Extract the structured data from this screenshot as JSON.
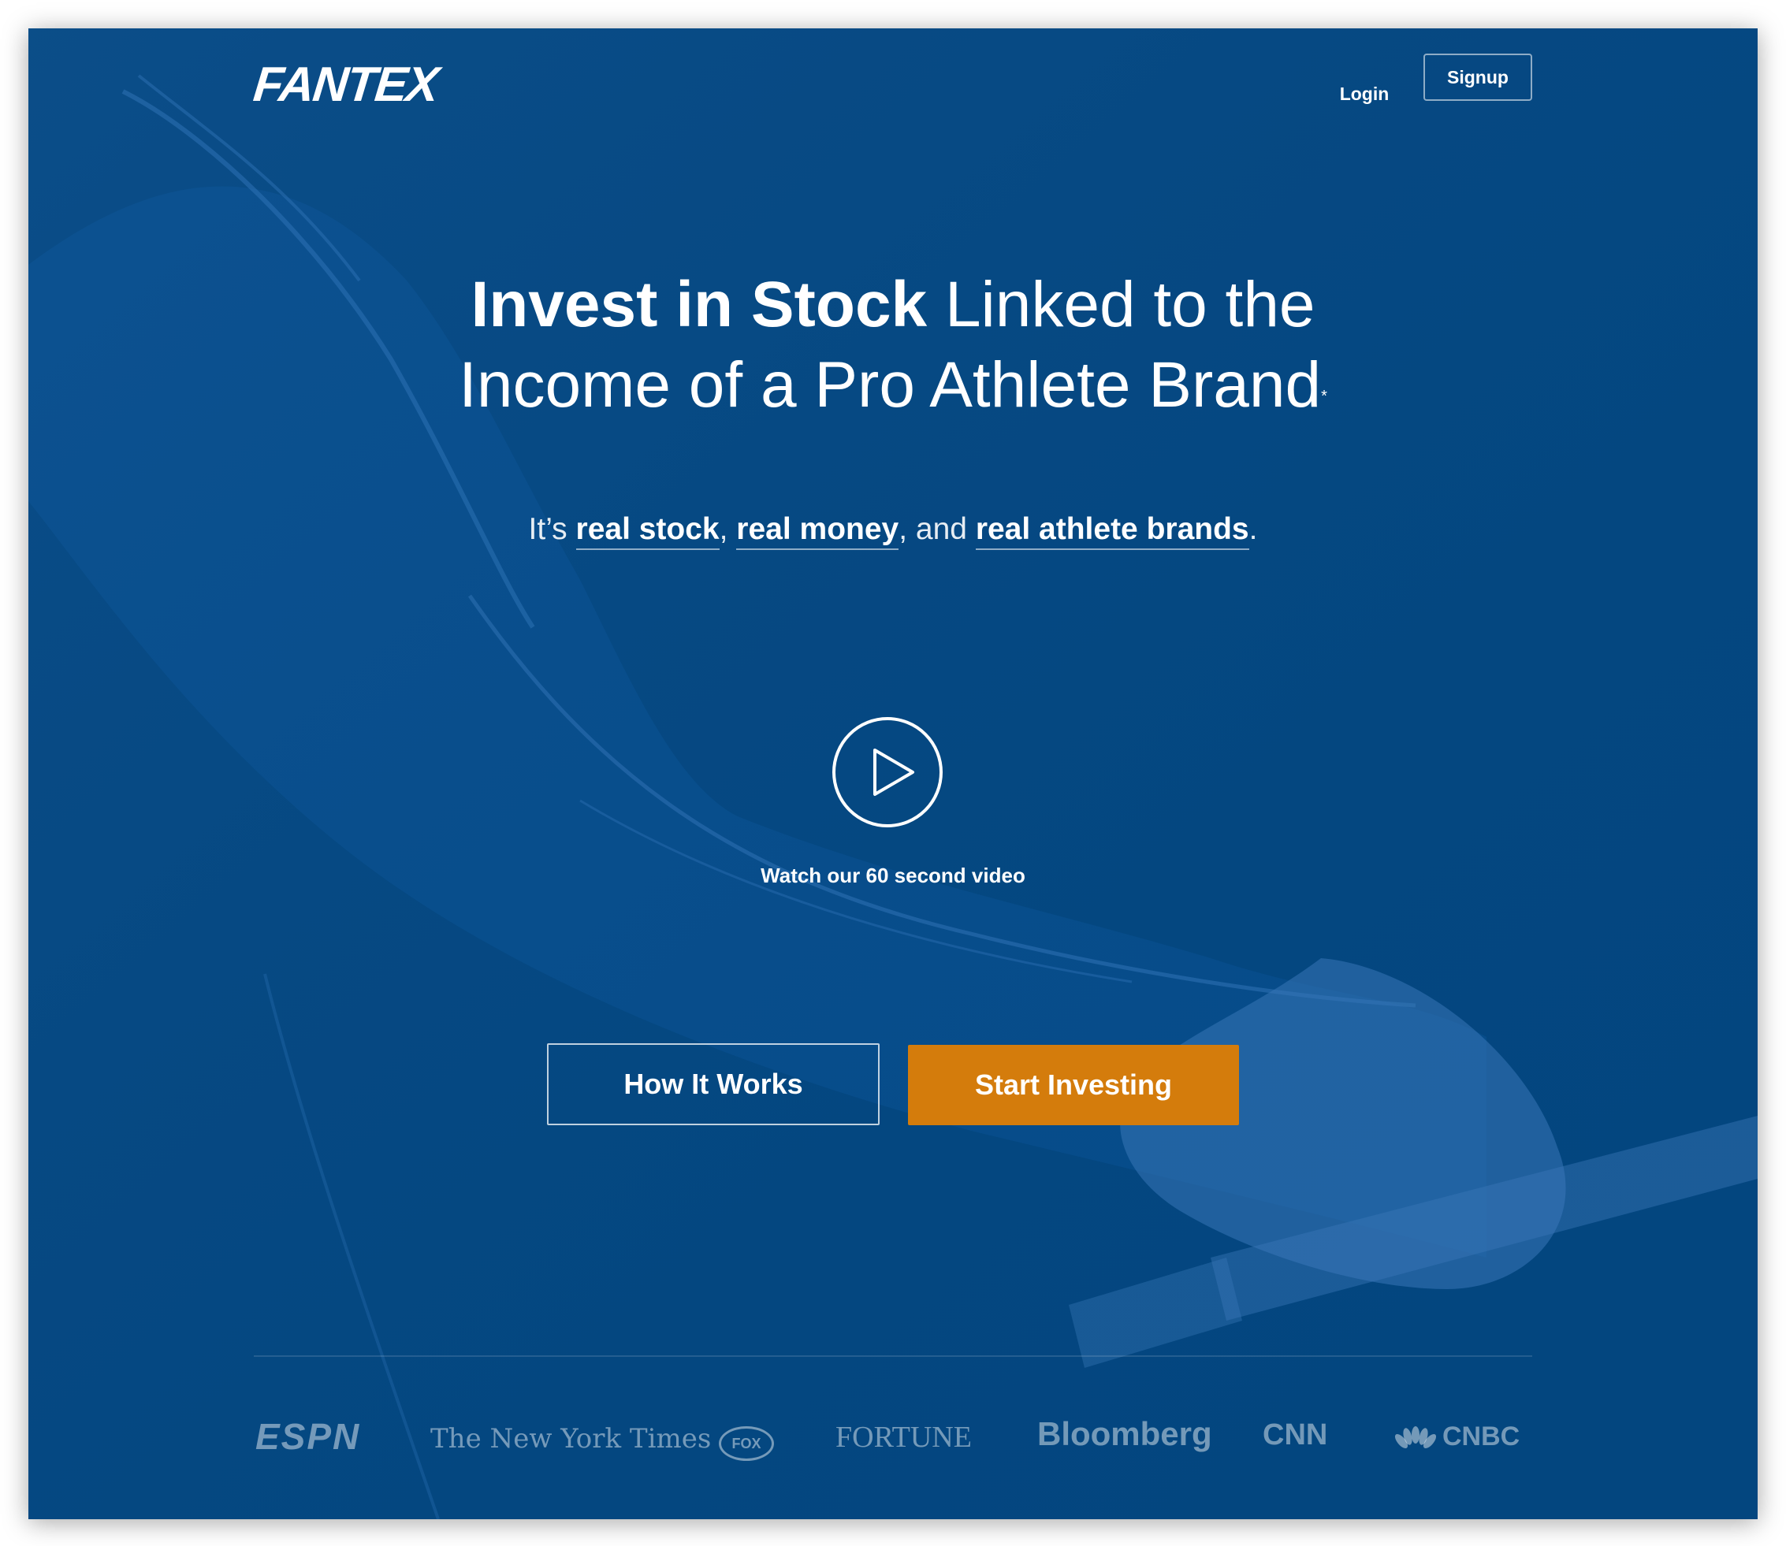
{
  "header": {
    "logo_text": "FANTEX",
    "login_label": "Login",
    "signup_label": "Signup"
  },
  "hero": {
    "headline_bold": "Invest in Stock",
    "headline_rest_line1": " Linked to the",
    "headline_line2": "Income of a Pro Athlete Brand",
    "headline_footnote": "*",
    "sub_prefix": "It’s ",
    "sub_link1": "real stock",
    "sub_sep1": ", ",
    "sub_link2": "real money",
    "sub_sep2": ", and ",
    "sub_link3": "real athlete brands",
    "sub_suffix": "."
  },
  "video": {
    "play_icon": "play-icon",
    "caption": "Watch our 60 second video"
  },
  "cta": {
    "how_label": "How It Works",
    "start_label": "Start Investing"
  },
  "colors": {
    "background": "#03467f",
    "cta_orange": "#d47c0c"
  },
  "press": {
    "espn": "ESPN",
    "nyt": "The New York Times",
    "fox": "FOX",
    "fortune": "FORTUNE",
    "bloomberg": "Bloomberg",
    "cnn": "CNN",
    "cnbc": "CNBC"
  }
}
